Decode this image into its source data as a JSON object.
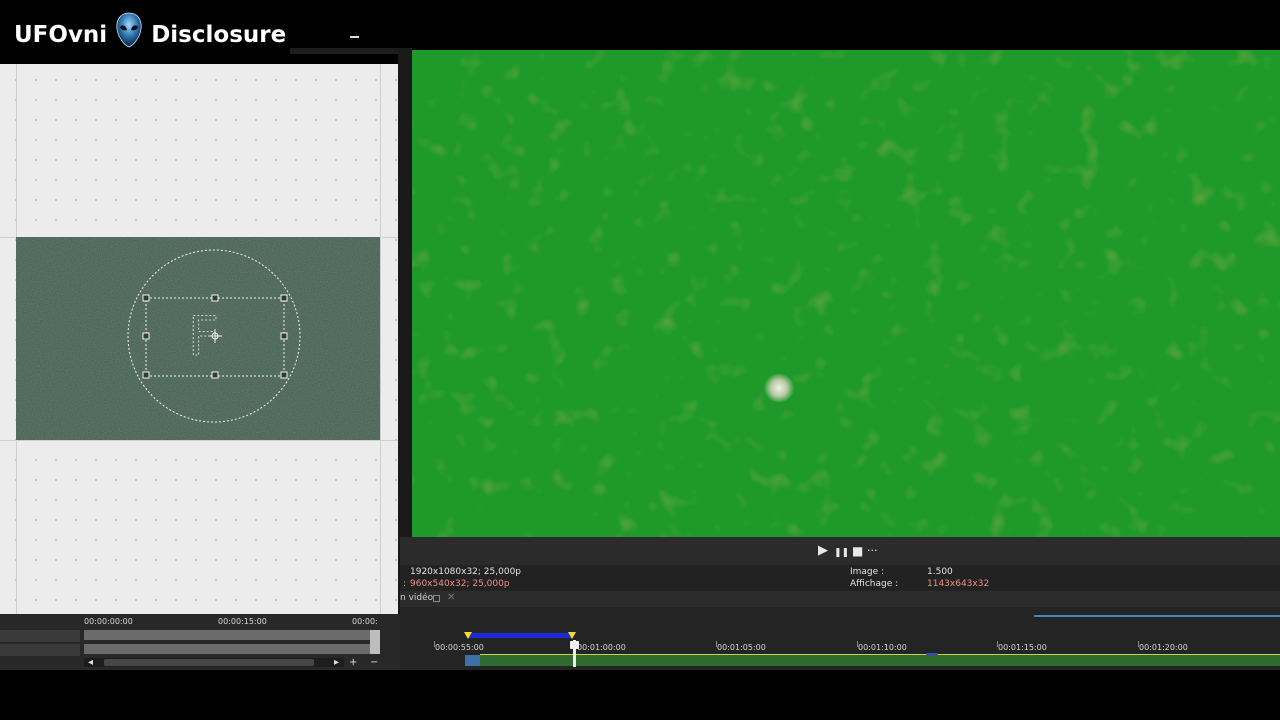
{
  "branding": {
    "name_left": "UFOvni",
    "name_right": "Disclosure",
    "icon": "alien-head-icon"
  },
  "preview": {
    "transport": {
      "play": "▶",
      "pause": "❚❚",
      "stop": "■",
      "more": "···"
    }
  },
  "info": {
    "project_props": "1920x1080x32; 25,000p",
    "preview_label": ":",
    "preview_props": "960x540x32; 25,000p",
    "image_label": "Image :",
    "image_value": "1.500",
    "display_label": "Affichage :",
    "display_value": "1143x643x32"
  },
  "tab": {
    "label": "n vidéo",
    "close": "✕"
  },
  "mini_timeline": {
    "ruler": [
      "00:00:00:00",
      "00:00:15:00",
      "00:00:"
    ],
    "buttons": [
      "◂",
      "▸",
      "+",
      "−"
    ]
  },
  "timeline": {
    "ruler": [
      "00:00:55:00",
      "00:01:00:00",
      "00:01:05:00",
      "00:01:10:00",
      "00:01:15:00",
      "00:01:20:00"
    ]
  },
  "track_motion": {
    "letter": "F"
  },
  "colors": {
    "video_green": "#1f9a2a",
    "selection_blue": "#1b2ad8",
    "marker_yellow": "#f2dd2a",
    "preview_props_red": "#ef8f80"
  }
}
